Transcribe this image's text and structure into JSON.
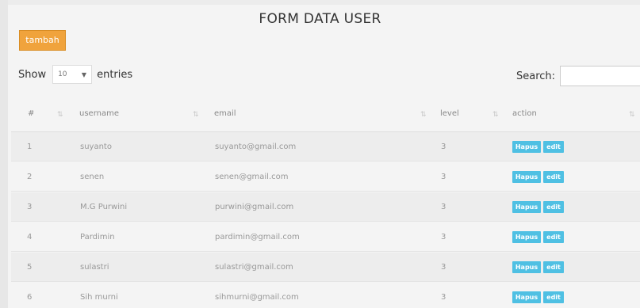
{
  "page": {
    "title": "FORM DATA USER"
  },
  "toolbar": {
    "add_label": "tambah"
  },
  "length": {
    "show_label": "Show",
    "value": "10",
    "suffix": "entries"
  },
  "search": {
    "label": "Search:",
    "value": ""
  },
  "table": {
    "columns": [
      "#",
      "username",
      "email",
      "level",
      "action"
    ],
    "rows": [
      {
        "no": "1",
        "username": "suyanto",
        "email": "suyanto@gmail.com",
        "level": "3"
      },
      {
        "no": "2",
        "username": "senen",
        "email": "senen@gmail.com",
        "level": "3"
      },
      {
        "no": "3",
        "username": "M.G Purwini",
        "email": "purwini@gmail.com",
        "level": "3"
      },
      {
        "no": "4",
        "username": "Pardimin",
        "email": "pardimin@gmail.com",
        "level": "3"
      },
      {
        "no": "5",
        "username": "sulastri",
        "email": "sulastri@gmail.com",
        "level": "3"
      },
      {
        "no": "6",
        "username": "Sih murni",
        "email": "sihmurni@gmail.com",
        "level": "3"
      }
    ],
    "delete_label": "Hapus",
    "edit_label": "edit"
  },
  "colors": {
    "primary_button": "#f0a33c",
    "action_button": "#4fc0e3"
  }
}
